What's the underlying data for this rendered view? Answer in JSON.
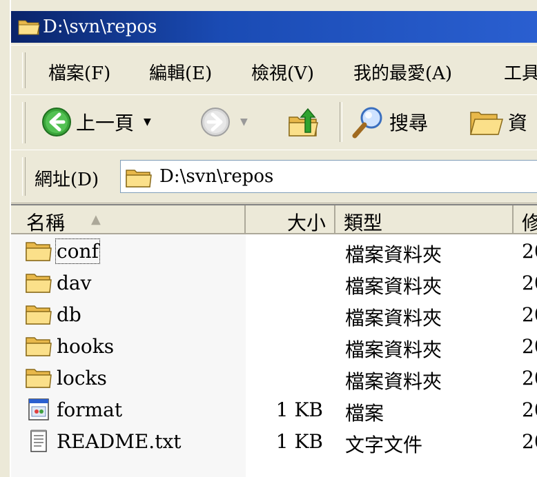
{
  "window": {
    "title": "D:\\svn\\repos"
  },
  "menubar": {
    "items": [
      "檔案(F)",
      "編輯(E)",
      "檢視(V)",
      "我的最愛(A)",
      "工具"
    ]
  },
  "toolbar": {
    "back_label": "上一頁",
    "search_label": "搜尋",
    "folders_label": "資"
  },
  "address": {
    "label": "網址(D)",
    "value": "D:\\svn\\repos"
  },
  "columns": {
    "name": "名稱",
    "size": "大小",
    "type": "類型",
    "modified": "修"
  },
  "files": [
    {
      "name": "conf",
      "size": "",
      "type": "檔案資料夾",
      "date": "20",
      "icon": "folder-icon"
    },
    {
      "name": "dav",
      "size": "",
      "type": "檔案資料夾",
      "date": "20",
      "icon": "folder-icon"
    },
    {
      "name": "db",
      "size": "",
      "type": "檔案資料夾",
      "date": "20",
      "icon": "folder-icon"
    },
    {
      "name": "hooks",
      "size": "",
      "type": "檔案資料夾",
      "date": "20",
      "icon": "folder-icon"
    },
    {
      "name": "locks",
      "size": "",
      "type": "檔案資料夾",
      "date": "20",
      "icon": "folder-icon"
    },
    {
      "name": "format",
      "size": "1 KB",
      "type": "檔案",
      "date": "20",
      "icon": "generic-file-icon"
    },
    {
      "name": "README.txt",
      "size": "1 KB",
      "type": "文字文件",
      "date": "20",
      "icon": "text-document-icon"
    }
  ]
}
